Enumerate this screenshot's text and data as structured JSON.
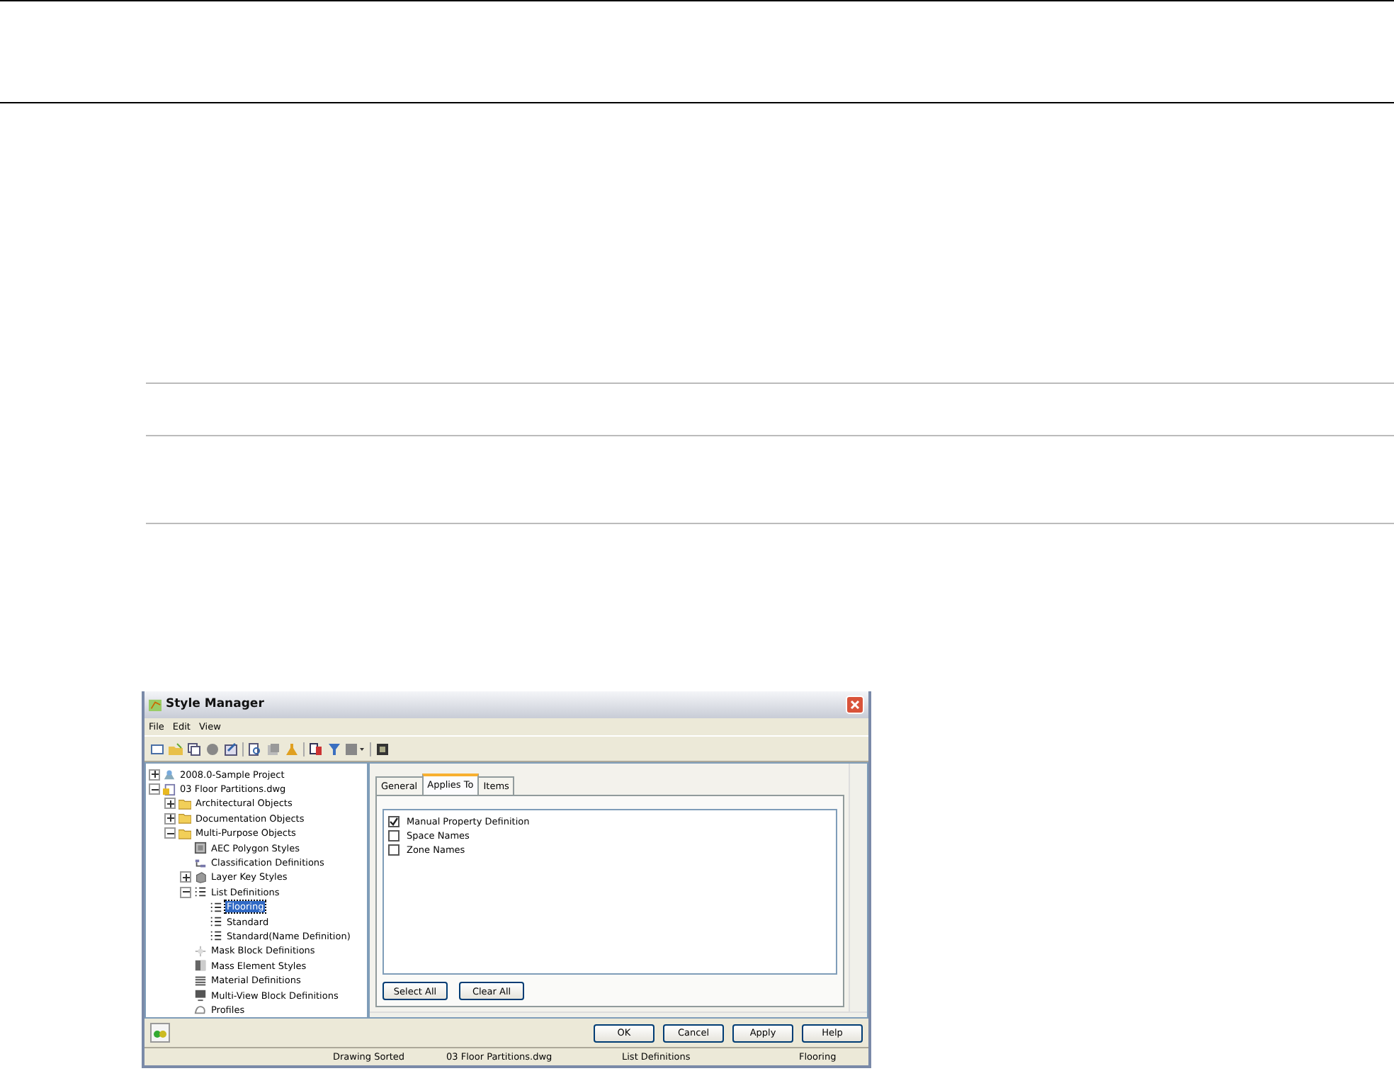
{
  "window": {
    "title": "Style Manager"
  },
  "menu": [
    "File",
    "Edit",
    "View"
  ],
  "tree": [
    {
      "label": "2008.0-Sample Project",
      "kind": "project",
      "expanded": false,
      "selected": false
    },
    {
      "label": "03 Floor Partitions.dwg",
      "kind": "drawing",
      "expanded": true,
      "selected": false,
      "children": [
        {
          "label": "Architectural Objects",
          "kind": "folder",
          "expanded": false,
          "selected": false
        },
        {
          "label": "Documentation Objects",
          "kind": "folder",
          "expanded": false,
          "selected": false
        },
        {
          "label": "Multi-Purpose Objects",
          "kind": "folder",
          "expanded": true,
          "selected": false,
          "children": [
            {
              "label": "AEC Polygon Styles",
              "kind": "polygon",
              "selected": false
            },
            {
              "label": "Classification Definitions",
              "kind": "classification",
              "selected": false
            },
            {
              "label": "Layer Key Styles",
              "kind": "layerkey",
              "expanded": false,
              "selected": false
            },
            {
              "label": "List Definitions",
              "kind": "list",
              "expanded": true,
              "selected": false,
              "children": [
                {
                  "label": "Flooring",
                  "kind": "list",
                  "selected": true
                },
                {
                  "label": "Standard",
                  "kind": "list",
                  "selected": false
                },
                {
                  "label": "Standard(Name Definition)",
                  "kind": "list",
                  "selected": false
                }
              ]
            },
            {
              "label": "Mask Block Definitions",
              "kind": "mask",
              "selected": false
            },
            {
              "label": "Mass Element Styles",
              "kind": "mass",
              "selected": false
            },
            {
              "label": "Material Definitions",
              "kind": "material",
              "selected": false
            },
            {
              "label": "Multi-View Block Definitions",
              "kind": "multiview",
              "selected": false
            },
            {
              "label": "Profiles",
              "kind": "profile",
              "selected": false
            }
          ]
        }
      ]
    }
  ],
  "tabs": [
    {
      "label": "General",
      "selected": false
    },
    {
      "label": "Applies To",
      "selected": true
    },
    {
      "label": "Items",
      "selected": false
    }
  ],
  "applies_to": [
    {
      "label": "Manual Property Definition",
      "checked": true
    },
    {
      "label": "Space Names",
      "checked": false
    },
    {
      "label": "Zone Names",
      "checked": false
    }
  ],
  "list_buttons": [
    "Select All",
    "Clear All"
  ],
  "dialog_buttons": [
    "OK",
    "Cancel",
    "Apply",
    "Help"
  ],
  "status_bar": [
    "Drawing Sorted",
    "03 Floor Partitions.dwg",
    "List Definitions",
    "Flooring"
  ]
}
